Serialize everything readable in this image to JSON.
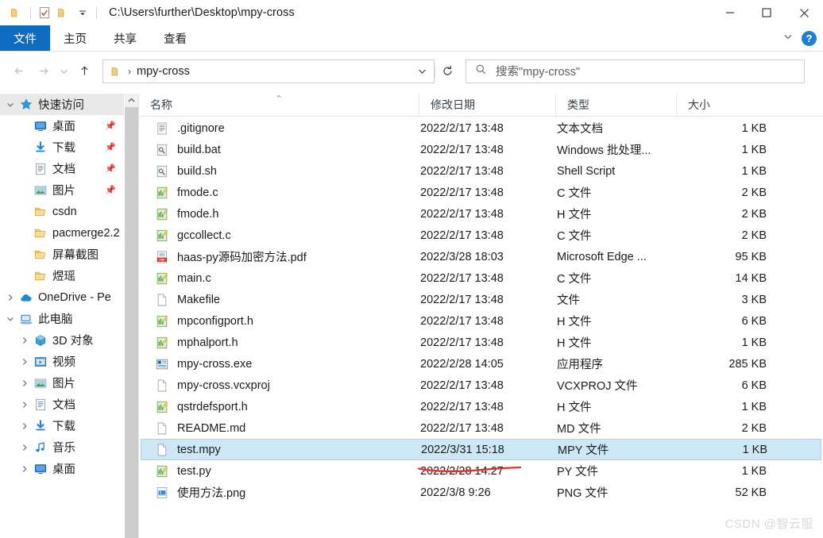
{
  "window": {
    "title_path": "C:\\Users\\further\\Desktop\\mpy-cross",
    "minimize_label": "─",
    "maximize_label": "☐",
    "close_label": "✕",
    "accent_color": "#0d6cbf",
    "selection_color": "#cce8f7",
    "annotation_color": "#e03131"
  },
  "quick_access_toolbar": {
    "folder_label": "",
    "properties_label": "",
    "new_folder_label": "",
    "customize_label": "⌄"
  },
  "ribbon": {
    "tabs": [
      {
        "label": "文件",
        "active": true
      },
      {
        "label": "主页",
        "active": false
      },
      {
        "label": "共享",
        "active": false
      },
      {
        "label": "查看",
        "active": false
      }
    ],
    "expand_label": "⌄",
    "help_label": "?"
  },
  "address_bar": {
    "back_label": "←",
    "forward_label": "→",
    "recent_label": "⌄",
    "up_label": "↑",
    "breadcrumb_separator": "›",
    "breadcrumb_text": "mpy-cross",
    "dropdown_label": "⌄",
    "refresh_label": "↻",
    "search_placeholder": "搜索\"mpy-cross\""
  },
  "columns": [
    {
      "label": "名称",
      "sorted": true,
      "sort_caret": "⌃"
    },
    {
      "label": "修改日期",
      "sorted": false,
      "sort_caret": ""
    },
    {
      "label": "类型",
      "sorted": false,
      "sort_caret": ""
    },
    {
      "label": "大小",
      "sorted": false,
      "sort_caret": ""
    }
  ],
  "sidebar": {
    "groups": [
      {
        "label": "快速访问",
        "icon": "star-icon",
        "expanded": true,
        "selected": true,
        "items": [
          {
            "label": "桌面",
            "icon": "desktop-icon",
            "pinned": true
          },
          {
            "label": "下载",
            "icon": "download-icon",
            "pinned": true
          },
          {
            "label": "文档",
            "icon": "documents-icon",
            "pinned": true
          },
          {
            "label": "图片",
            "icon": "pictures-icon",
            "pinned": true
          },
          {
            "label": "csdn",
            "icon": "folder-icon",
            "pinned": false
          },
          {
            "label": "pacmerge2.2",
            "icon": "folder-icon",
            "pinned": false
          },
          {
            "label": "屏幕截图",
            "icon": "folder-icon",
            "pinned": false
          },
          {
            "label": "煜瑶",
            "icon": "folder-icon",
            "pinned": false
          }
        ]
      },
      {
        "label": "OneDrive - Pe",
        "icon": "onedrive-icon",
        "expanded": false,
        "selected": false,
        "items": []
      },
      {
        "label": "此电脑",
        "icon": "thispc-icon",
        "expanded": true,
        "selected": false,
        "items": [
          {
            "label": "3D 对象",
            "icon": "3dobjects-icon",
            "pinned": false,
            "chevron": true
          },
          {
            "label": "视频",
            "icon": "videos-icon",
            "pinned": false,
            "chevron": true
          },
          {
            "label": "图片",
            "icon": "pictures-icon",
            "pinned": false,
            "chevron": true
          },
          {
            "label": "文档",
            "icon": "documents-icon",
            "pinned": false,
            "chevron": true
          },
          {
            "label": "下载",
            "icon": "download-icon",
            "pinned": false,
            "chevron": true
          },
          {
            "label": "音乐",
            "icon": "music-icon",
            "pinned": false,
            "chevron": true
          },
          {
            "label": "桌面",
            "icon": "desktop-icon",
            "pinned": false,
            "chevron": true
          }
        ]
      }
    ],
    "scroll_up_label": "⌃"
  },
  "files": [
    {
      "name": ".gitignore",
      "date": "2022/2/17 13:48",
      "type": "文本文档",
      "size": "1 KB",
      "icon": "text-file-icon",
      "selected": false
    },
    {
      "name": "build.bat",
      "date": "2022/2/17 13:48",
      "type": "Windows 批处理...",
      "size": "1 KB",
      "icon": "script-file-icon",
      "selected": false
    },
    {
      "name": "build.sh",
      "date": "2022/2/17 13:48",
      "type": "Shell Script",
      "size": "1 KB",
      "icon": "script-file-icon",
      "selected": false
    },
    {
      "name": "fmode.c",
      "date": "2022/2/17 13:48",
      "type": "C 文件",
      "size": "2 KB",
      "icon": "source-file-icon",
      "selected": false
    },
    {
      "name": "fmode.h",
      "date": "2022/2/17 13:48",
      "type": "H 文件",
      "size": "2 KB",
      "icon": "source-file-icon",
      "selected": false
    },
    {
      "name": "gccollect.c",
      "date": "2022/2/17 13:48",
      "type": "C 文件",
      "size": "2 KB",
      "icon": "source-file-icon",
      "selected": false
    },
    {
      "name": "haas-py源码加密方法.pdf",
      "date": "2022/3/28 18:03",
      "type": "Microsoft Edge ...",
      "size": "95 KB",
      "icon": "pdf-file-icon",
      "selected": false
    },
    {
      "name": "main.c",
      "date": "2022/2/17 13:48",
      "type": "C 文件",
      "size": "14 KB",
      "icon": "source-file-icon",
      "selected": false
    },
    {
      "name": "Makefile",
      "date": "2022/2/17 13:48",
      "type": "文件",
      "size": "3 KB",
      "icon": "blank-file-icon",
      "selected": false
    },
    {
      "name": "mpconfigport.h",
      "date": "2022/2/17 13:48",
      "type": "H 文件",
      "size": "6 KB",
      "icon": "source-file-icon",
      "selected": false
    },
    {
      "name": "mphalport.h",
      "date": "2022/2/17 13:48",
      "type": "H 文件",
      "size": "1 KB",
      "icon": "source-file-icon",
      "selected": false
    },
    {
      "name": "mpy-cross.exe",
      "date": "2022/2/28 14:05",
      "type": "应用程序",
      "size": "285 KB",
      "icon": "application-icon",
      "selected": false
    },
    {
      "name": "mpy-cross.vcxproj",
      "date": "2022/2/17 13:48",
      "type": "VCXPROJ 文件",
      "size": "6 KB",
      "icon": "blank-file-icon",
      "selected": false
    },
    {
      "name": "qstrdefsport.h",
      "date": "2022/2/17 13:48",
      "type": "H 文件",
      "size": "1 KB",
      "icon": "source-file-icon",
      "selected": false
    },
    {
      "name": "README.md",
      "date": "2022/2/17 13:48",
      "type": "MD 文件",
      "size": "2 KB",
      "icon": "blank-file-icon",
      "selected": false
    },
    {
      "name": "test.mpy",
      "date": "2022/3/31 15:18",
      "type": "MPY 文件",
      "size": "1 KB",
      "icon": "blank-file-icon",
      "selected": true
    },
    {
      "name": "test.py",
      "date": "2022/2/28 14:27",
      "type": "PY 文件",
      "size": "1 KB",
      "icon": "source-file-icon",
      "selected": false
    },
    {
      "name": "使用方法.png",
      "date": "2022/3/8 9:26",
      "type": "PNG 文件",
      "size": "52 KB",
      "icon": "image-file-icon",
      "selected": false
    }
  ],
  "watermark": {
    "text": "CSDN @智云服"
  }
}
